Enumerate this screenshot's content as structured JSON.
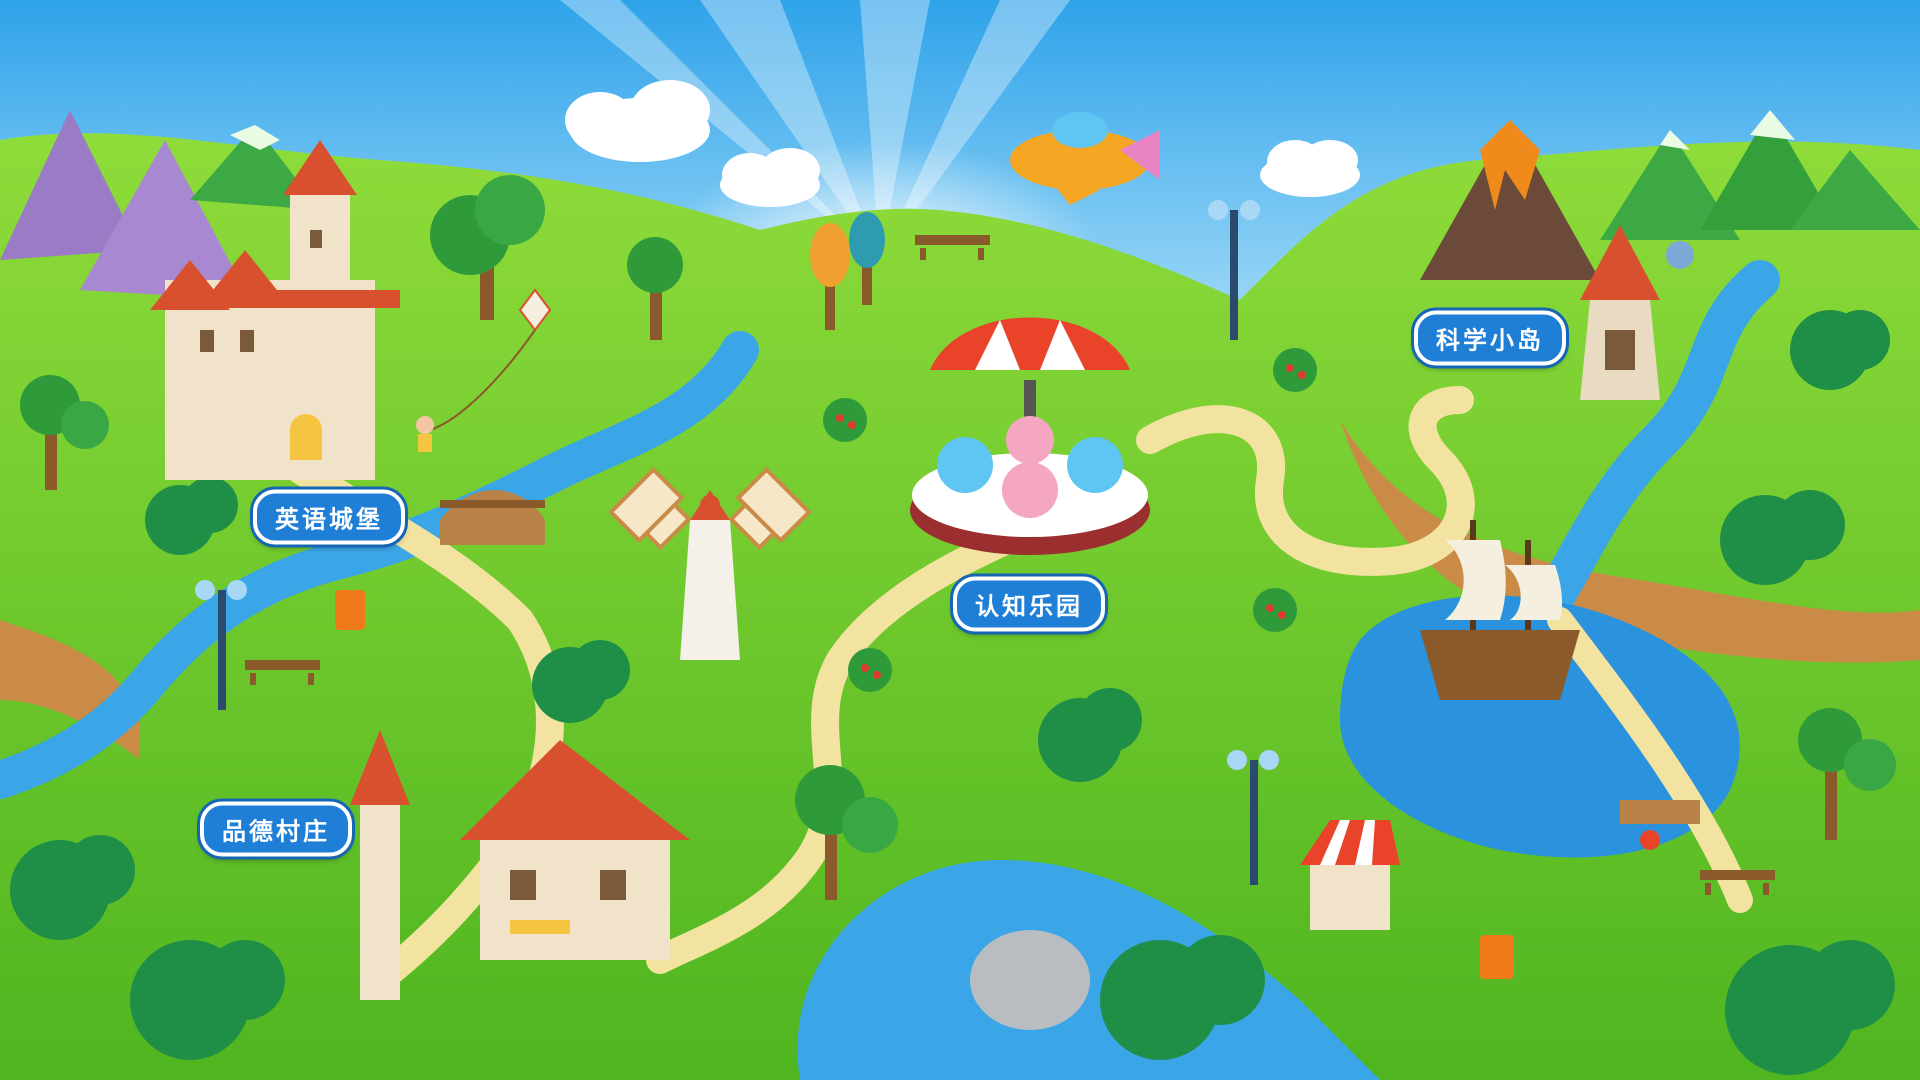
{
  "map": {
    "locations": [
      {
        "id": "english-castle",
        "label": "英语城堡"
      },
      {
        "id": "cognition-park",
        "label": "认知乐园"
      },
      {
        "id": "science-island",
        "label": "科学小岛"
      },
      {
        "id": "morality-village",
        "label": "品德村庄"
      }
    ]
  },
  "colors": {
    "sky": "#47b4f0",
    "grass": "#6fcd2c",
    "water": "#3aa6e8",
    "path": "#f3e3a0",
    "label_bg": "#1f7fd6"
  },
  "icons": [
    "castle",
    "carousel",
    "lighthouse",
    "village-house",
    "windmill",
    "airplane",
    "pirate-ship",
    "volcano",
    "bridge",
    "lamp-post",
    "bench",
    "trash-bin",
    "market-stall"
  ]
}
